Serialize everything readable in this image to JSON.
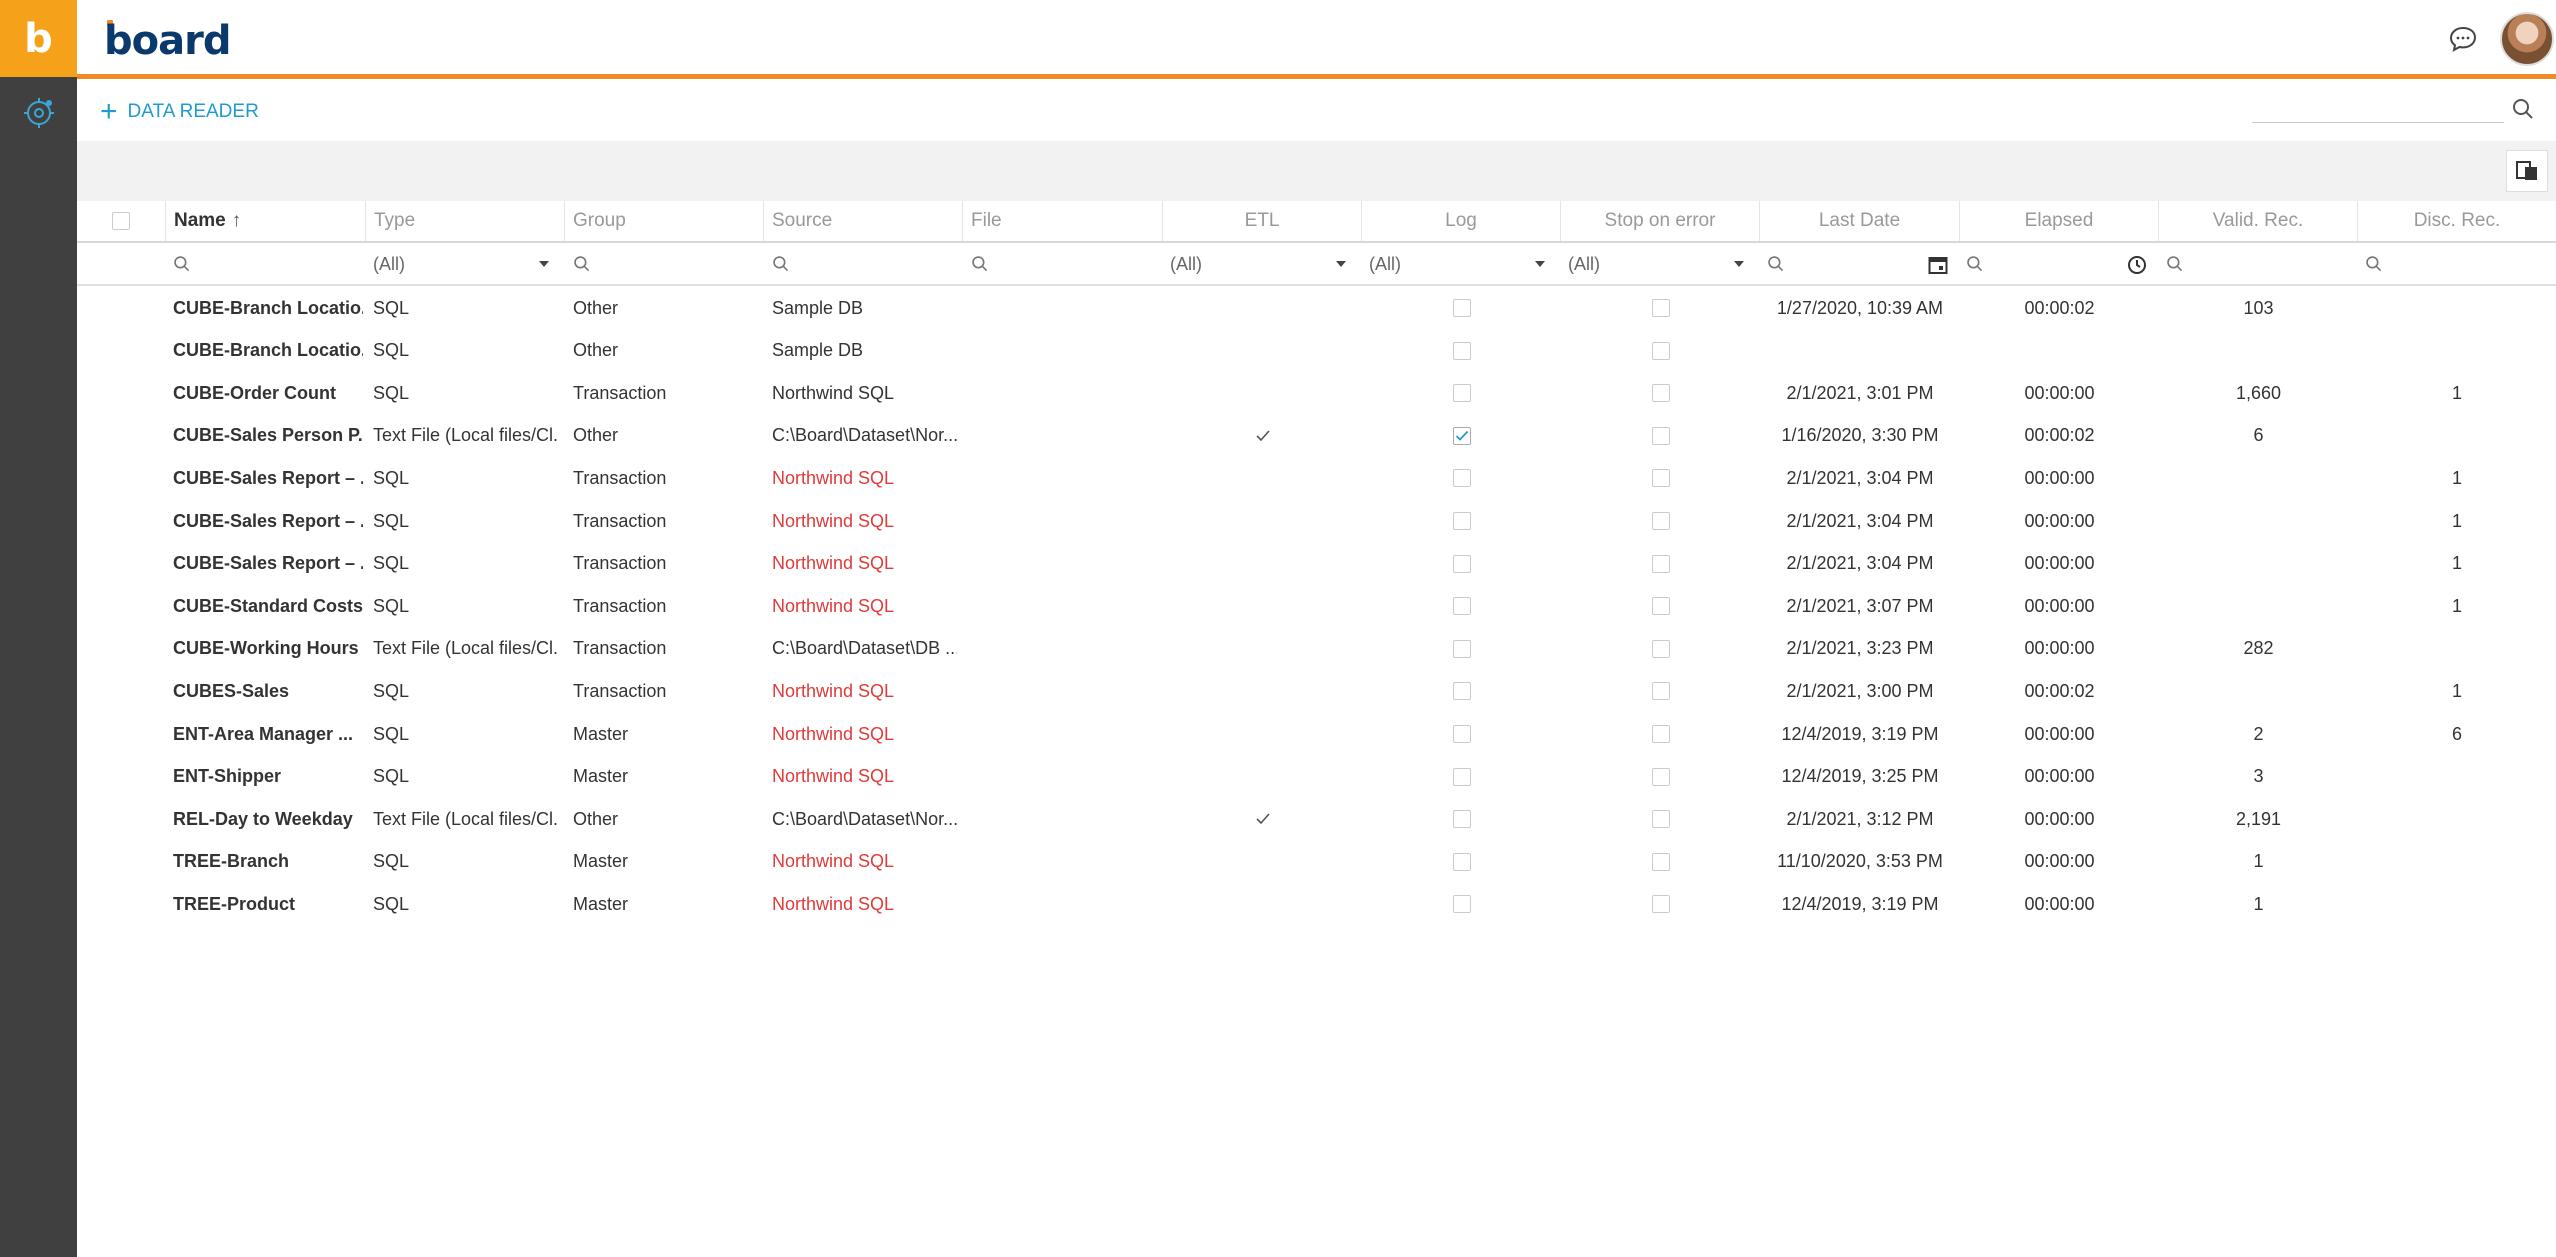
{
  "rail": {
    "logo_letter": "b",
    "icon": "dataflow-icon"
  },
  "header": {
    "brand": "board",
    "chat_icon": "chat-icon",
    "avatar": "user-avatar"
  },
  "toolbar": {
    "add_label": "DATA READER",
    "search_placeholder": ""
  },
  "columns": [
    {
      "key": "name",
      "label": "Name",
      "sort": "asc"
    },
    {
      "key": "type",
      "label": "Type"
    },
    {
      "key": "group",
      "label": "Group"
    },
    {
      "key": "source",
      "label": "Source"
    },
    {
      "key": "file",
      "label": "File"
    },
    {
      "key": "etl",
      "label": "ETL"
    },
    {
      "key": "log",
      "label": "Log"
    },
    {
      "key": "stop",
      "label": "Stop on error"
    },
    {
      "key": "last_date",
      "label": "Last Date"
    },
    {
      "key": "elapsed",
      "label": "Elapsed"
    },
    {
      "key": "valid",
      "label": "Valid. Rec."
    },
    {
      "key": "disc",
      "label": "Disc. Rec."
    }
  ],
  "filters": {
    "type": "(All)",
    "etl": "(All)",
    "log": "(All)",
    "stop": "(All)"
  },
  "colors": {
    "accent": "#F08A24",
    "link": "#1f9bd1",
    "error": "#e03a3a",
    "rail": "#404040",
    "logo_bg": "#F5A11A"
  },
  "rows": [
    {
      "name": "CUBE-Branch Locatio...",
      "type": "SQL",
      "group": "Other",
      "source": "Sample DB",
      "source_error": false,
      "etl": false,
      "log": false,
      "stop": false,
      "last_date": "1/27/2020, 10:39 AM",
      "elapsed": "00:00:02",
      "valid": "103",
      "disc": ""
    },
    {
      "name": "CUBE-Branch Locatio...",
      "type": "SQL",
      "group": "Other",
      "source": "Sample DB",
      "source_error": false,
      "etl": false,
      "log": false,
      "stop": false,
      "last_date": "",
      "elapsed": "",
      "valid": "",
      "disc": ""
    },
    {
      "name": "CUBE-Order Count",
      "type": "SQL",
      "group": "Transaction",
      "source": "Northwind SQL",
      "source_error": false,
      "etl": false,
      "log": false,
      "stop": false,
      "last_date": "2/1/2021, 3:01 PM",
      "elapsed": "00:00:00",
      "valid": "1,660",
      "disc": "1"
    },
    {
      "name": "CUBE-Sales Person P...",
      "type": "Text File (Local files/Cl...",
      "group": "Other",
      "source": "C:\\Board\\Dataset\\Nor...",
      "source_error": false,
      "etl": true,
      "log": true,
      "stop": false,
      "last_date": "1/16/2020, 3:30 PM",
      "elapsed": "00:00:02",
      "valid": "6",
      "disc": ""
    },
    {
      "name": "CUBE-Sales Report – ...",
      "type": "SQL",
      "group": "Transaction",
      "source": "Northwind SQL",
      "source_error": true,
      "etl": false,
      "log": false,
      "stop": false,
      "last_date": "2/1/2021, 3:04 PM",
      "elapsed": "00:00:00",
      "valid": "",
      "disc": "1"
    },
    {
      "name": "CUBE-Sales Report – ...",
      "type": "SQL",
      "group": "Transaction",
      "source": "Northwind SQL",
      "source_error": true,
      "etl": false,
      "log": false,
      "stop": false,
      "last_date": "2/1/2021, 3:04 PM",
      "elapsed": "00:00:00",
      "valid": "",
      "disc": "1"
    },
    {
      "name": "CUBE-Sales Report – ...",
      "type": "SQL",
      "group": "Transaction",
      "source": "Northwind SQL",
      "source_error": true,
      "etl": false,
      "log": false,
      "stop": false,
      "last_date": "2/1/2021, 3:04 PM",
      "elapsed": "00:00:00",
      "valid": "",
      "disc": "1"
    },
    {
      "name": "CUBE-Standard Costs",
      "type": "SQL",
      "group": "Transaction",
      "source": "Northwind SQL",
      "source_error": true,
      "etl": false,
      "log": false,
      "stop": false,
      "last_date": "2/1/2021, 3:07 PM",
      "elapsed": "00:00:00",
      "valid": "",
      "disc": "1"
    },
    {
      "name": "CUBE-Working Hours",
      "type": "Text File (Local files/Cl...",
      "group": "Transaction",
      "source": "C:\\Board\\Dataset\\DB ...",
      "source_error": false,
      "etl": false,
      "log": false,
      "stop": false,
      "last_date": "2/1/2021, 3:23 PM",
      "elapsed": "00:00:00",
      "valid": "282",
      "disc": ""
    },
    {
      "name": "CUBES-Sales",
      "type": "SQL",
      "group": "Transaction",
      "source": "Northwind SQL",
      "source_error": true,
      "etl": false,
      "log": false,
      "stop": false,
      "last_date": "2/1/2021, 3:00 PM",
      "elapsed": "00:00:02",
      "valid": "",
      "disc": "1"
    },
    {
      "name": "ENT-Area Manager ...",
      "type": "SQL",
      "group": "Master",
      "source": "Northwind SQL",
      "source_error": true,
      "etl": false,
      "log": false,
      "stop": false,
      "last_date": "12/4/2019, 3:19 PM",
      "elapsed": "00:00:00",
      "valid": "2",
      "disc": "6"
    },
    {
      "name": "ENT-Shipper",
      "type": "SQL",
      "group": "Master",
      "source": "Northwind SQL",
      "source_error": true,
      "etl": false,
      "log": false,
      "stop": false,
      "last_date": "12/4/2019, 3:25 PM",
      "elapsed": "00:00:00",
      "valid": "3",
      "disc": ""
    },
    {
      "name": "REL-Day to Weekday",
      "type": "Text File (Local files/Cl...",
      "group": "Other",
      "source": "C:\\Board\\Dataset\\Nor...",
      "source_error": false,
      "etl": true,
      "log": false,
      "stop": false,
      "last_date": "2/1/2021, 3:12 PM",
      "elapsed": "00:00:00",
      "valid": "2,191",
      "disc": ""
    },
    {
      "name": "TREE-Branch",
      "type": "SQL",
      "group": "Master",
      "source": "Northwind SQL",
      "source_error": true,
      "etl": false,
      "log": false,
      "stop": false,
      "last_date": "11/10/2020, 3:53 PM",
      "elapsed": "00:00:00",
      "valid": "1",
      "disc": ""
    },
    {
      "name": "TREE-Product",
      "type": "SQL",
      "group": "Master",
      "source": "Northwind SQL",
      "source_error": true,
      "etl": false,
      "log": false,
      "stop": false,
      "last_date": "12/4/2019, 3:19 PM",
      "elapsed": "00:00:00",
      "valid": "1",
      "disc": ""
    }
  ]
}
